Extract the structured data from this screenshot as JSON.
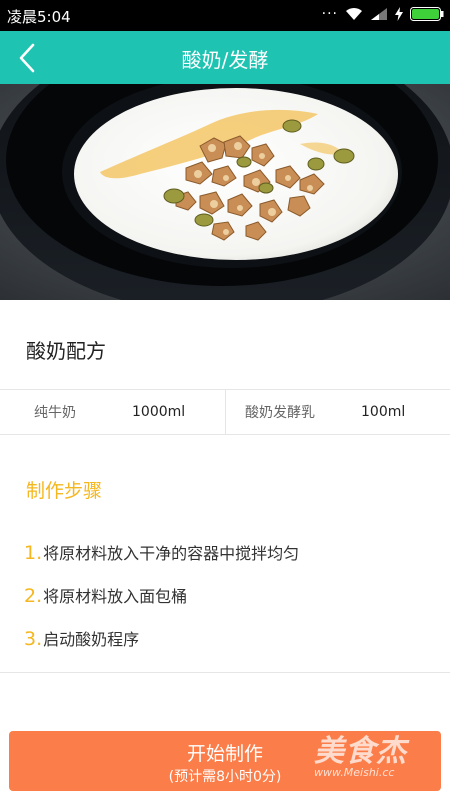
{
  "status_bar": {
    "time": "凌晨5:04",
    "icons": [
      "dots-icon",
      "wifi-icon",
      "signal-icon",
      "charging-icon",
      "battery-icon"
    ]
  },
  "header": {
    "title": "酸奶/发酵",
    "back_icon": "chevron-left-icon",
    "color": "#1ec3b1"
  },
  "hero": {
    "subject": "yogurt-bowl-with-nuts"
  },
  "recipe": {
    "title": "酸奶配方",
    "ingredients": [
      {
        "name": "纯牛奶",
        "amount": "1000ml"
      },
      {
        "name": "酸奶发酵乳",
        "amount": "100ml"
      }
    ]
  },
  "steps": {
    "title": "制作步骤",
    "accent": "#f5b71f",
    "items": [
      {
        "num": "1.",
        "text": "将原材料放入干净的容器中搅拌均匀"
      },
      {
        "num": "2.",
        "text": "将原材料放入面包桶"
      },
      {
        "num": "3.",
        "text": "启动酸奶程序"
      }
    ]
  },
  "start_button": {
    "label": "开始制作",
    "sublabel": "(预计需8小时0分)",
    "color": "#fb7d49"
  },
  "watermark": {
    "text": "美食杰",
    "url": "www.Meishi.cc"
  }
}
